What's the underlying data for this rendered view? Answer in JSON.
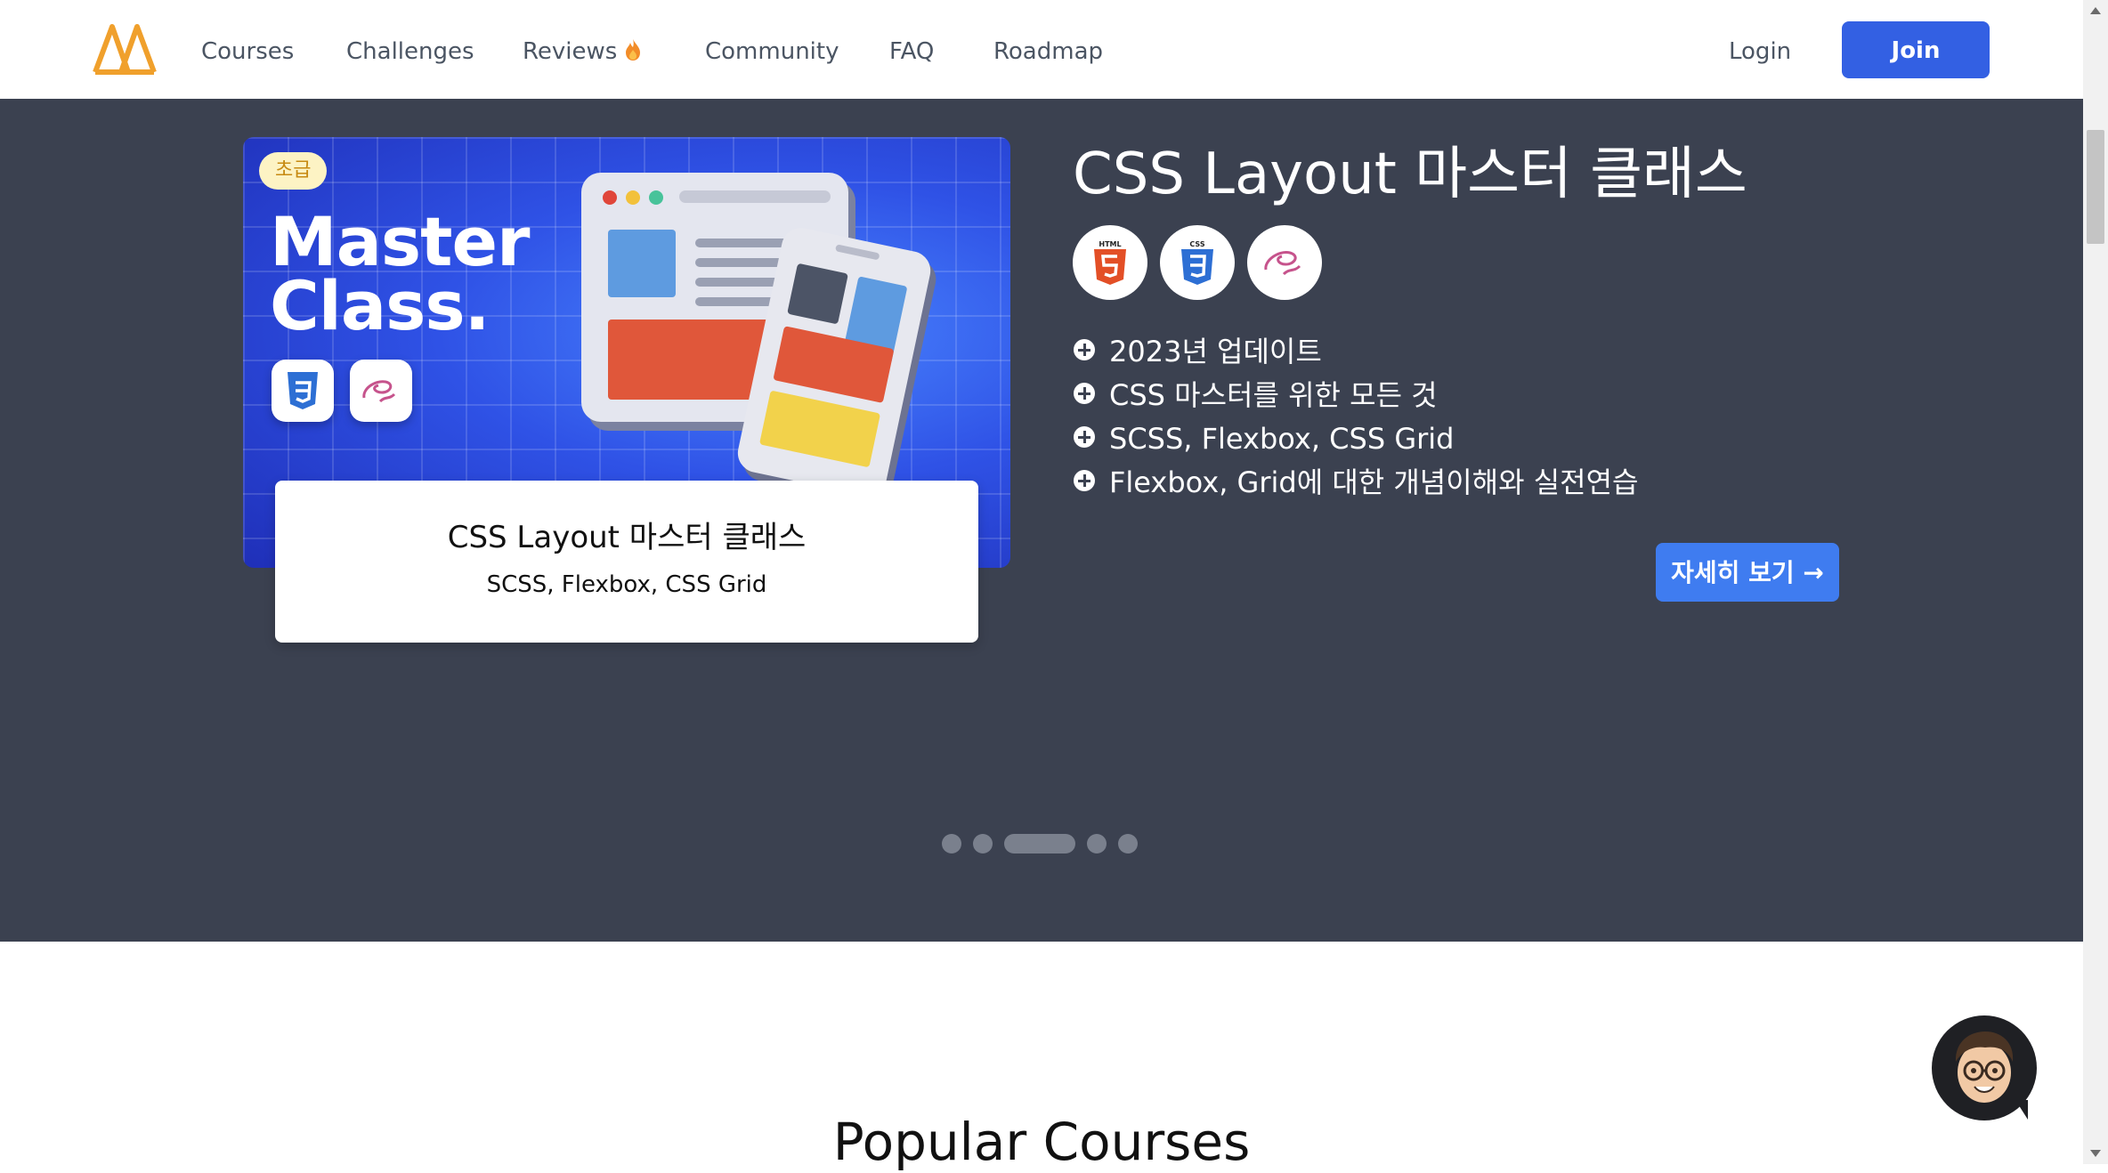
{
  "nav": {
    "items": [
      {
        "label": "Courses"
      },
      {
        "label": "Challenges"
      },
      {
        "label": "Reviews"
      },
      {
        "label": "Community"
      },
      {
        "label": "FAQ"
      },
      {
        "label": "Roadmap"
      }
    ],
    "reviews_icon": "fire-icon",
    "login_label": "Login",
    "join_label": "Join"
  },
  "hero": {
    "banner": {
      "badge": "초급",
      "headline_line1": "Master",
      "headline_line2": "Class."
    },
    "card": {
      "title": "CSS Layout 마스터 클래스",
      "subtitle": "SCSS, Flexbox, CSS Grid"
    },
    "title": "CSS Layout 마스터 클래스",
    "tech_icons": [
      "html5-icon",
      "css3-icon",
      "sass-icon"
    ],
    "features": [
      "2023년 업데이트",
      "CSS 마스터를 위한 모든 것",
      "SCSS, Flexbox, CSS Grid",
      "Flexbox, Grid에 대한 개념이해와 실전연습"
    ],
    "detail_button": "자세히 보기 →",
    "carousel": {
      "count": 5,
      "active_index": 2
    }
  },
  "popular": {
    "title": "Popular Courses"
  },
  "colors": {
    "primary": "#3360e3",
    "hero_bg": "#3b4150",
    "detail_button": "#3f7cf0",
    "logo": "#f0a02c"
  }
}
